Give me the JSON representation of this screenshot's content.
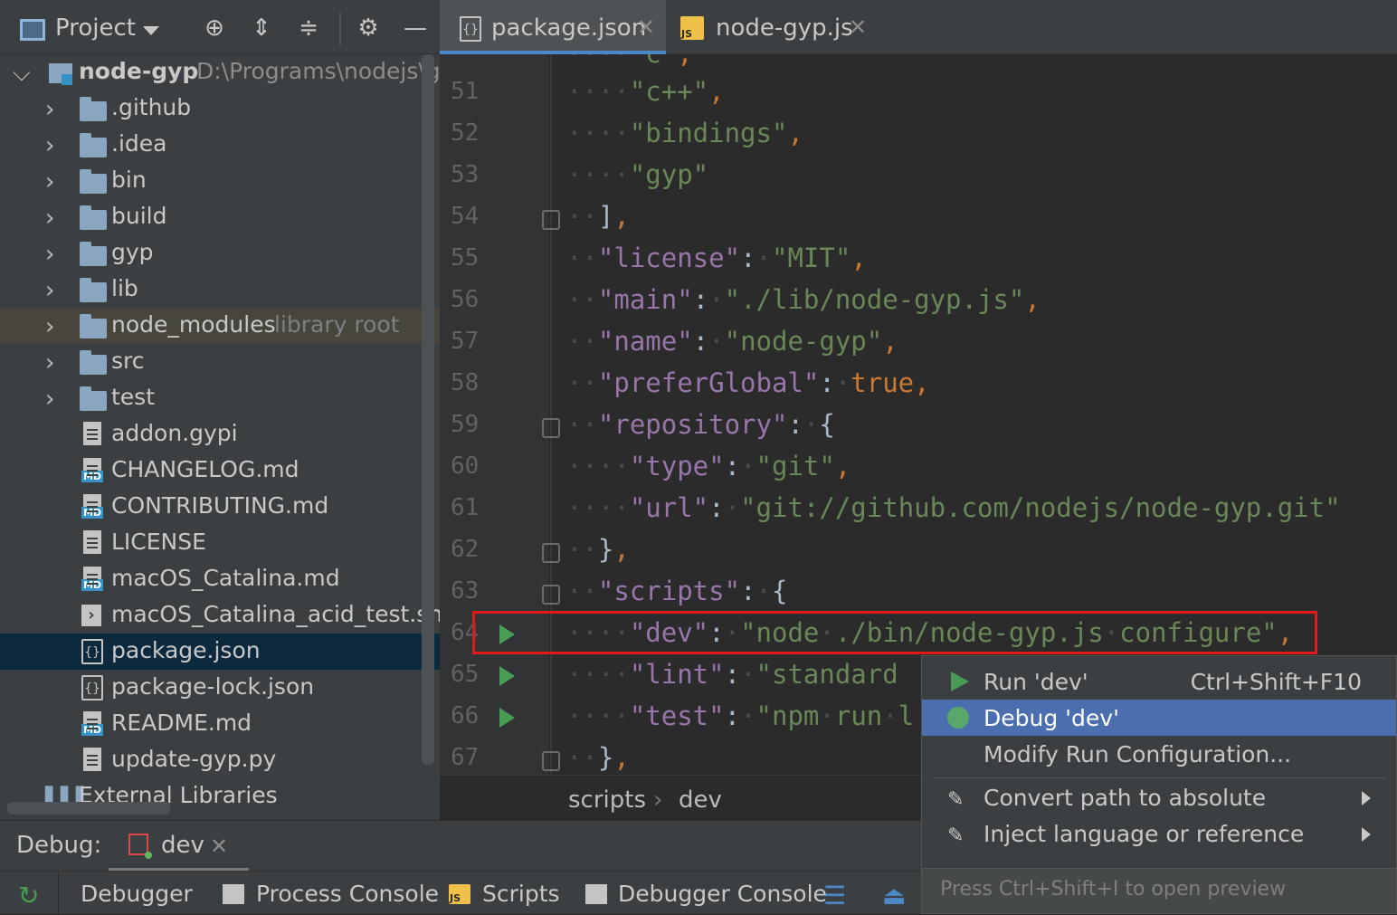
{
  "project": {
    "title": "Project",
    "root_name": "node-gyp",
    "root_path": "D:\\Programs\\nodejs\\gl",
    "tree": [
      {
        "label": ".github",
        "type": "folder"
      },
      {
        "label": ".idea",
        "type": "folder"
      },
      {
        "label": "bin",
        "type": "folder"
      },
      {
        "label": "build",
        "type": "folder"
      },
      {
        "label": "gyp",
        "type": "folder"
      },
      {
        "label": "lib",
        "type": "folder"
      },
      {
        "label": "node_modules",
        "type": "folder",
        "hint": "library root"
      },
      {
        "label": "src",
        "type": "folder"
      },
      {
        "label": "test",
        "type": "folder"
      },
      {
        "label": "addon.gypi",
        "type": "file"
      },
      {
        "label": "CHANGELOG.md",
        "type": "md"
      },
      {
        "label": "CONTRIBUTING.md",
        "type": "md"
      },
      {
        "label": "LICENSE",
        "type": "file"
      },
      {
        "label": "macOS_Catalina.md",
        "type": "md"
      },
      {
        "label": "macOS_Catalina_acid_test.sh",
        "type": "sh"
      },
      {
        "label": "package.json",
        "type": "json"
      },
      {
        "label": "package-lock.json",
        "type": "json"
      },
      {
        "label": "README.md",
        "type": "md"
      },
      {
        "label": "update-gyp.py",
        "type": "file"
      }
    ],
    "external_libraries": "External Libraries"
  },
  "tabs": [
    {
      "label": "package.json",
      "active": true
    },
    {
      "label": "node-gyp.js",
      "active": false
    }
  ],
  "editor": {
    "line_numbers": [
      "51",
      "52",
      "53",
      "54",
      "55",
      "56",
      "57",
      "58",
      "59",
      "60",
      "61",
      "62",
      "63",
      "64",
      "65",
      "66",
      "67"
    ]
  },
  "breadcrumb": [
    "scripts",
    "dev"
  ],
  "debug": {
    "label": "Debug:",
    "tab": "dev"
  },
  "toolbar": [
    "Debugger",
    "Process Console",
    "Scripts",
    "Debugger Console"
  ],
  "menu": {
    "run": "Run 'dev'",
    "run_shortcut": "Ctrl+Shift+F10",
    "debug": "Debug 'dev'",
    "modify": "Modify Run Configuration...",
    "convert": "Convert path to absolute",
    "inject": "Inject language or reference",
    "footer": "Press Ctrl+Shift+I to open preview"
  },
  "colors": {
    "accent": "#4b6eaf",
    "highlight_box": "#e0191a",
    "run": "#499c54"
  }
}
